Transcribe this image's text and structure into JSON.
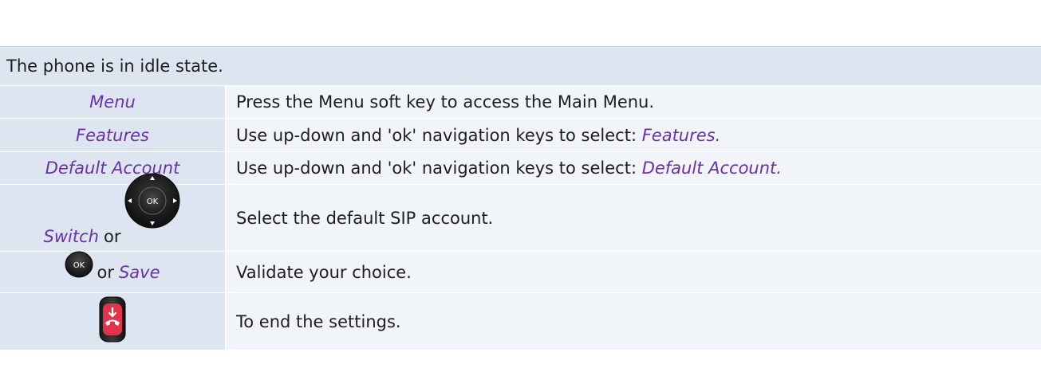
{
  "header": {
    "text": "The phone is in idle state."
  },
  "rows": [
    {
      "step": "Menu",
      "desc": "Press the Menu soft key to access the Main Menu."
    },
    {
      "step": "Features",
      "desc_prefix": "Use up-down and 'ok' navigation keys to select: ",
      "desc_em": "Features."
    },
    {
      "step": "Default Account",
      "desc_prefix": "Use up-down and 'ok' navigation keys to select: ",
      "desc_em": "Default Account."
    },
    {
      "step": "Switch",
      "connector": "or",
      "icon": "navigation-pad-icon",
      "icon_label": "OK",
      "desc": "Select the default SIP account."
    },
    {
      "icon": "ok-key-icon",
      "icon_label": "OK",
      "connector": "or",
      "step": "Save",
      "desc": "Validate your choice."
    },
    {
      "icon": "end-call-key-icon",
      "desc": "To end the settings."
    }
  ],
  "colors": {
    "label_bg": "#dde6f0",
    "desc_bg": "#f1f4f8",
    "accent_text": "#6a30a8",
    "end_key_red": "#e0344a"
  }
}
